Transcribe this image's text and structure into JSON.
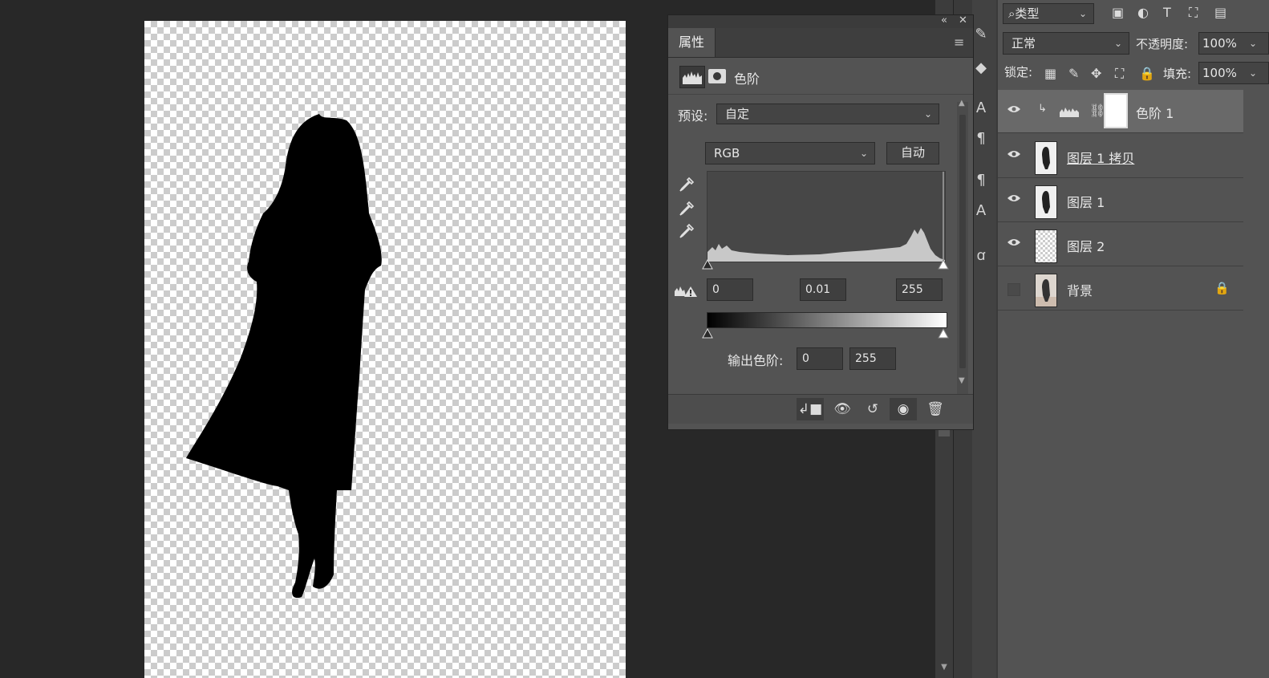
{
  "properties_panel": {
    "tab_label": "属性",
    "adjustment_label": "色阶",
    "preset_label": "预设:",
    "preset_value": "自定",
    "channel_value": "RGB",
    "auto_label": "自动",
    "input_black": "0",
    "input_gamma": "0.01",
    "input_white": "255",
    "output_label": "输出色阶:",
    "output_black": "0",
    "output_white": "255"
  },
  "layers_panel": {
    "filter_label": "类型",
    "blend_mode": "正常",
    "opacity_label": "不透明度:",
    "opacity_value": "100%",
    "lock_label": "锁定:",
    "fill_label": "填充:",
    "fill_value": "100%",
    "layers": [
      {
        "name": "色阶 1",
        "visible": true,
        "type": "adjustment",
        "selected": true
      },
      {
        "name": "图层 1 拷贝",
        "visible": true,
        "type": "image"
      },
      {
        "name": "图层 1",
        "visible": true,
        "type": "image"
      },
      {
        "name": "图层 2",
        "visible": true,
        "type": "transparent"
      },
      {
        "name": "背景",
        "visible": false,
        "type": "background",
        "locked": true
      }
    ]
  },
  "icons": [
    "close-icon",
    "collapse-icon",
    "panel-menu-icon",
    "eyedropper-icon",
    "clip-to-layer-icon",
    "view-previous-icon",
    "reset-icon",
    "visibility-icon",
    "trash-icon",
    "eye-icon",
    "lock-icon",
    "link-icon"
  ]
}
